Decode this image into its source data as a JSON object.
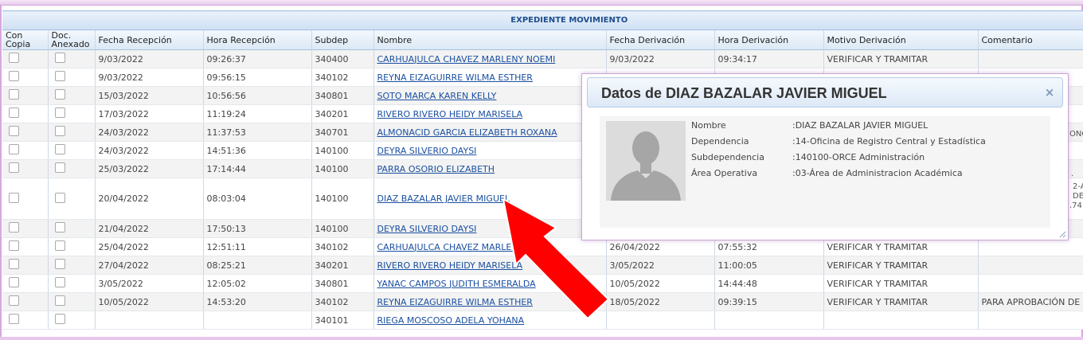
{
  "group_header": "EXPEDIENTE MOVIMIENTO",
  "columns": {
    "con_copia": "Con\nCopia",
    "con_copia_l1": "Con",
    "con_copia_l2": "Copia",
    "doc_l1": "Doc.",
    "doc_l2": "Anexado",
    "fecha_recepcion": "Fecha Recepción",
    "hora_recepcion": "Hora Recepción",
    "subdep": "Subdep",
    "nombre": "Nombre",
    "fecha_derivacion": "Fecha Derivación",
    "hora_derivacion": "Hora Derivación",
    "motivo": "Motivo Derivación",
    "comentario": "Comentario"
  },
  "rows": [
    {
      "fr": "9/03/2022",
      "hr": "09:26:37",
      "sub": "340400",
      "nombre": "CARHUAJULCA CHAVEZ MARLENY NOEMI",
      "fd": "9/03/2022",
      "hd": "09:34:17",
      "motivo": "VERIFICAR Y TRAMITAR",
      "com": ""
    },
    {
      "fr": "9/03/2022",
      "hr": "09:56:15",
      "sub": "340102",
      "nombre": "REYNA EIZAGUIRRE WILMA ESTHER",
      "fd": "",
      "hd": "",
      "motivo": "",
      "com": ""
    },
    {
      "fr": "15/03/2022",
      "hr": "10:56:56",
      "sub": "340801",
      "nombre": "SOTO MARCA KAREN KELLY",
      "fd": "",
      "hd": "",
      "motivo": "",
      "com": ""
    },
    {
      "fr": "17/03/2022",
      "hr": "11:19:24",
      "sub": "340201",
      "nombre": "RIVERO RIVERO HEIDY MARISELA",
      "fd": "",
      "hd": "",
      "motivo": "",
      "com": ""
    },
    {
      "fr": "24/03/2022",
      "hr": "11:37:53",
      "sub": "340701",
      "nombre": "ALMONACID GARCIA ELIZABETH ROXANA",
      "fd": "",
      "hd": "",
      "motivo": "",
      "com": ""
    },
    {
      "fr": "24/03/2022",
      "hr": "14:51:36",
      "sub": "140100",
      "nombre": "DEYRA SILVERIO DAYSI",
      "fd": "",
      "hd": "",
      "motivo": "",
      "com": ""
    },
    {
      "fr": "25/03/2022",
      "hr": "17:14:44",
      "sub": "140100",
      "nombre": "PARRA OSORIO ELIZABETH",
      "fd": "",
      "hd": "",
      "motivo": "",
      "com": ""
    },
    {
      "fr": "20/04/2022",
      "hr": "08:03:04",
      "sub": "140100",
      "nombre": "DIAZ BAZALAR JAVIER MIGUEL",
      "fd": "",
      "hd": "",
      "motivo": "",
      "com": ""
    },
    {
      "fr": "21/04/2022",
      "hr": "17:50:13",
      "sub": "140100",
      "nombre": "DEYRA SILVERIO DAYSI",
      "fd": "",
      "hd": "",
      "motivo": "",
      "com": ""
    },
    {
      "fr": "25/04/2022",
      "hr": "12:51:11",
      "sub": "340102",
      "nombre": "CARHUAJULCA CHAVEZ MARLENY N",
      "fd": "26/04/2022",
      "hd": "07:55:32",
      "motivo": "VERIFICAR Y TRAMITAR",
      "com": ""
    },
    {
      "fr": "27/04/2022",
      "hr": "08:25:21",
      "sub": "340201",
      "nombre": "RIVERO RIVERO HEIDY MARISELA",
      "fd": "3/05/2022",
      "hd": "11:00:05",
      "motivo": "VERIFICAR Y TRAMITAR",
      "com": ""
    },
    {
      "fr": "3/05/2022",
      "hr": "12:05:02",
      "sub": "340801",
      "nombre": "YANAC CAMPOS JUDITH ESMERALDA",
      "fd": "10/05/2022",
      "hd": "14:44:48",
      "motivo": "VERIFICAR Y TRAMITAR",
      "com": ""
    },
    {
      "fr": "10/05/2022",
      "hr": "14:53:20",
      "sub": "340102",
      "nombre": "REYNA EIZAGUIRRE WILMA ESTHER",
      "fd": "18/05/2022",
      "hd": "09:39:15",
      "motivo": "VERIFICAR Y TRAMITAR",
      "com": "PARA APROBACIÓN DE"
    },
    {
      "fr": "",
      "hr": "",
      "sub": "340101",
      "nombre": "RIEGA MOSCOSO ADELA YOHANA",
      "fd": "",
      "hd": "",
      "motivo": "",
      "com": ""
    }
  ],
  "behind_dialog_fragments": [
    "ONC",
    "2-A",
    "DE",
    ".74",
    "."
  ],
  "dialog": {
    "title": "Datos de DIAZ BAZALAR JAVIER MIGUEL",
    "close_glyph": "×",
    "fields": [
      {
        "label": "Nombre",
        "value": ":DIAZ BAZALAR JAVIER MIGUEL"
      },
      {
        "label": "Dependencia",
        "value": ":14-Oficina de Registro Central y Estadística"
      },
      {
        "label": "Subdependencia",
        "value": ":140100-ORCE Administración"
      },
      {
        "label": "Área Operativa",
        "value": ":03-Área de Administracion Académica"
      }
    ],
    "avatar_icon": "user-silhouette-icon"
  },
  "colors": {
    "link": "#1a4fa0",
    "header_text": "#1f4e8c",
    "arrow": "#ff0000",
    "frame": "#d9a6e0"
  }
}
